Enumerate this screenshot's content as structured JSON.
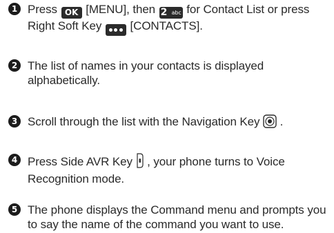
{
  "icons": {
    "ok_key": "ok-key-icon",
    "key_2abc": "key-2abc-icon",
    "soft_key": "right-soft-key-icon",
    "navigation_key": "navigation-key-icon",
    "side_avr_key": "side-avr-key-icon"
  },
  "keys": {
    "ok_label": "OK",
    "two_digit": "2",
    "two_sub": "abc"
  },
  "steps": [
    {
      "number": "1",
      "text_a": "Press ",
      "text_b": " [MENU], then ",
      "text_c": " for Contact List or press Right Soft Key ",
      "text_d": " [CONTACTS]."
    },
    {
      "number": "2",
      "text": "The list of names in your contacts is displayed alphabetically."
    },
    {
      "number": "3",
      "text_a": "Scroll through the list with the Navigation Key ",
      "text_b": " ."
    },
    {
      "number": "4",
      "text_a": "Press Side AVR Key ",
      "text_b": " , your phone turns to Voice Recognition mode."
    },
    {
      "number": "5",
      "text": "The phone displays the Command menu and prompts you to say the name of the command you want to use."
    }
  ],
  "colors": {
    "text": "#2a2a2a",
    "number_badge": "#1c1c1c",
    "key_background": "#2b2b2b"
  }
}
